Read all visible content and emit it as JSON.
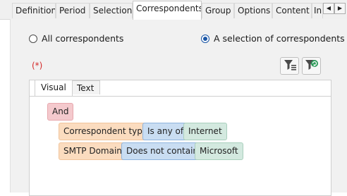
{
  "tabs": [
    {
      "label": "Definition",
      "active": false
    },
    {
      "label": "Period",
      "active": false
    },
    {
      "label": "Selection",
      "active": false
    },
    {
      "label": "Correspondents",
      "active": true
    },
    {
      "label": "Group",
      "active": false
    },
    {
      "label": "Options",
      "active": false
    },
    {
      "label": "Content",
      "active": false
    },
    {
      "label": "In",
      "active": false
    }
  ],
  "scroll": {
    "left": "◀",
    "right": "▶"
  },
  "scope": {
    "all_label": "All correspondents",
    "selection_label": "A selection of correspondents",
    "selected": "selection"
  },
  "required_marker": "(*)",
  "toolbar": {
    "filter_icon": "filter-clear-icon",
    "filter_add_icon": "filter-add-icon"
  },
  "editor": {
    "tabs": [
      {
        "label": "Visual",
        "active": true
      },
      {
        "label": "Text",
        "active": false
      }
    ],
    "operator": "And",
    "conditions": [
      {
        "field": "Correspondent type",
        "comparison": "Is any of",
        "value": "Internet"
      },
      {
        "field": "SMTP Domain",
        "comparison": "Does not contain",
        "value": "Microsoft"
      }
    ]
  },
  "colors": {
    "operator": "#f4c9cd",
    "field": "#fbdcbf",
    "comparison": "#c9ddf2",
    "value": "#d3e9df",
    "required": "#d42a2a",
    "radio_selected": "#1a56a6"
  }
}
